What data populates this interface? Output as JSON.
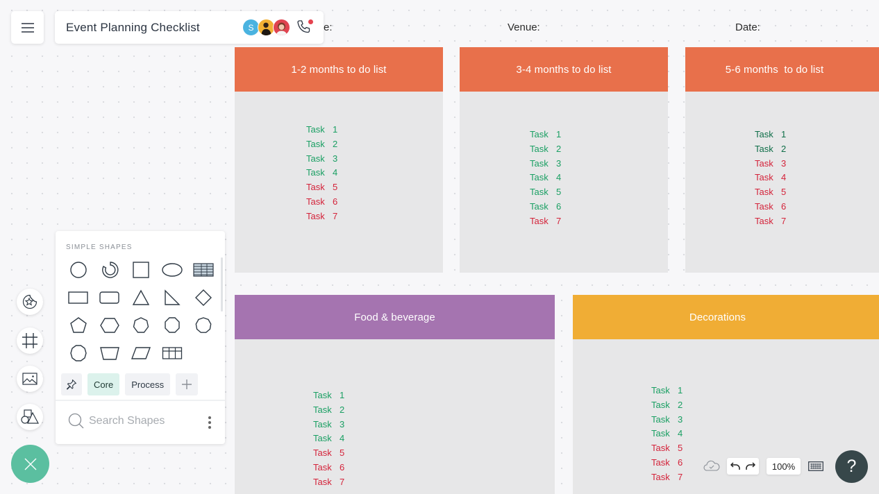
{
  "header": {
    "document_title": "Event Planning Checklist",
    "collaborators": [
      {
        "initial": "S",
        "color": "#4ab3e0"
      },
      {
        "initial": "",
        "color": "#f2b134"
      },
      {
        "initial": "",
        "color": "#e0444f"
      }
    ],
    "call_icon": "phone-icon",
    "menu_icon": "hamburger-menu-icon"
  },
  "form_fields": {
    "name_label_partial": "e:",
    "venue_label": "Venue:",
    "date_label": "Date:"
  },
  "colors": {
    "header_orange": "#e8704b",
    "header_purple": "#a574b0",
    "header_yellow": "#f0ad35",
    "panel_bg": "#e7e7e8",
    "task_done_green": "#1a9f63",
    "task_done_dark_green": "#0f6e48",
    "task_pending_red": "#d4233a",
    "accent_teal": "#5bbfa0"
  },
  "panels": [
    {
      "title": "1-2 months to do list",
      "tasks": [
        {
          "label": "Task",
          "num": "1",
          "status": "done"
        },
        {
          "label": "Task",
          "num": "2",
          "status": "done"
        },
        {
          "label": "Task",
          "num": "3",
          "status": "done"
        },
        {
          "label": "Task",
          "num": "4",
          "status": "done"
        },
        {
          "label": "Task",
          "num": "5",
          "status": "pending"
        },
        {
          "label": "Task",
          "num": "6",
          "status": "pending"
        },
        {
          "label": "Task",
          "num": "7",
          "status": "pending"
        }
      ]
    },
    {
      "title": "3-4 months to do list",
      "tasks": [
        {
          "label": "Task",
          "num": "1",
          "status": "done"
        },
        {
          "label": "Task",
          "num": "2",
          "status": "done"
        },
        {
          "label": "Task",
          "num": "3",
          "status": "done"
        },
        {
          "label": "Task",
          "num": "4",
          "status": "done"
        },
        {
          "label": "Task",
          "num": "5",
          "status": "done"
        },
        {
          "label": "Task",
          "num": "6",
          "status": "done"
        },
        {
          "label": "Task",
          "num": "7",
          "status": "pending"
        }
      ]
    },
    {
      "title": "5-6 months  to do list",
      "tasks": [
        {
          "label": "Task",
          "num": "1",
          "status": "done"
        },
        {
          "label": "Task",
          "num": "2",
          "status": "done"
        },
        {
          "label": "Task",
          "num": "3",
          "status": "pending"
        },
        {
          "label": "Task",
          "num": "4",
          "status": "pending"
        },
        {
          "label": "Task",
          "num": "5",
          "status": "pending"
        },
        {
          "label": "Task",
          "num": "6",
          "status": "pending"
        },
        {
          "label": "Task",
          "num": "7",
          "status": "pending"
        }
      ]
    },
    {
      "title": "Food & beverage",
      "tasks": [
        {
          "label": "Task",
          "num": "1",
          "status": "done"
        },
        {
          "label": "Task",
          "num": "2",
          "status": "done"
        },
        {
          "label": "Task",
          "num": "3",
          "status": "done"
        },
        {
          "label": "Task",
          "num": "4",
          "status": "done"
        },
        {
          "label": "Task",
          "num": "5",
          "status": "pending"
        },
        {
          "label": "Task",
          "num": "6",
          "status": "pending"
        },
        {
          "label": "Task",
          "num": "7",
          "status": "pending"
        }
      ]
    },
    {
      "title": "Decorations",
      "tasks": [
        {
          "label": "Task",
          "num": "1",
          "status": "done"
        },
        {
          "label": "Task",
          "num": "2",
          "status": "done"
        },
        {
          "label": "Task",
          "num": "3",
          "status": "done"
        },
        {
          "label": "Task",
          "num": "4",
          "status": "done"
        },
        {
          "label": "Task",
          "num": "5",
          "status": "pending"
        },
        {
          "label": "Task",
          "num": "6",
          "status": "pending"
        },
        {
          "label": "Task",
          "num": "7",
          "status": "pending"
        }
      ]
    }
  ],
  "shapes_panel": {
    "section_title": "SIMPLE SHAPES",
    "shapes": [
      "circle",
      "arc-ring",
      "square",
      "ellipse",
      "table-striped",
      "rectangle",
      "rounded-rectangle",
      "triangle",
      "right-triangle",
      "diamond",
      "pentagon",
      "hexagon",
      "heptagon",
      "octagon",
      "nonagon",
      "decagon",
      "trapezoid",
      "parallelogram",
      "grid-table"
    ],
    "tabs": [
      {
        "label": "",
        "icon": "pin-icon"
      },
      {
        "label": "Core",
        "active": true
      },
      {
        "label": "Process",
        "active": false
      },
      {
        "label": "",
        "icon": "plus-icon"
      }
    ],
    "search_placeholder": "Search Shapes"
  },
  "left_toolbar": [
    "sticker-star-icon",
    "frame-icon",
    "image-icon",
    "shapes-icon"
  ],
  "bottom_bar": {
    "zoom_level": "100%",
    "help_label": "?"
  }
}
